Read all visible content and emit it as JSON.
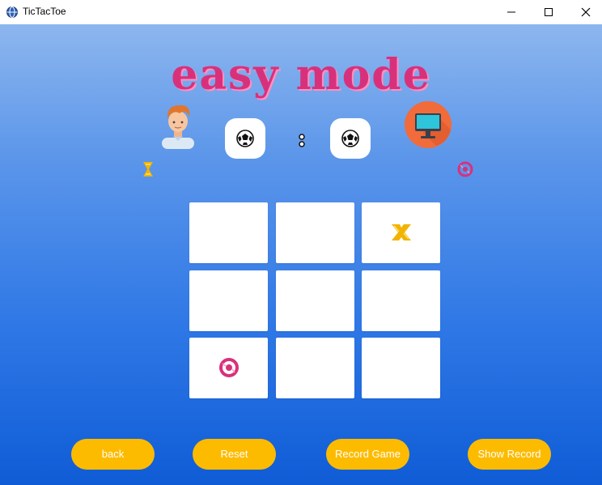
{
  "window": {
    "title": "TicTacToe"
  },
  "header": {
    "mode_title": "easy mode"
  },
  "players": {
    "user_icon": "person-avatar-icon",
    "cpu_icon": "computer-monitor-icon",
    "user_marker": "X",
    "cpu_marker": "O"
  },
  "score": {
    "separator_icon": "colon-icon",
    "user_icon": "soccer-ball-icon",
    "cpu_icon": "soccer-ball-icon"
  },
  "board": {
    "cells": [
      "",
      "",
      "X",
      "",
      "",
      "",
      "O",
      "",
      ""
    ]
  },
  "buttons": {
    "back": "back",
    "reset": "Reset",
    "record_game": "Record Game",
    "show_record": "Show Record"
  },
  "colors": {
    "accent": "#fdbb00",
    "title": "#d8317c",
    "x_mark": "#f2b400",
    "o_mark": "#d8317c",
    "background_top": "#8db6ee",
    "background_bottom": "#0f5cd6"
  }
}
